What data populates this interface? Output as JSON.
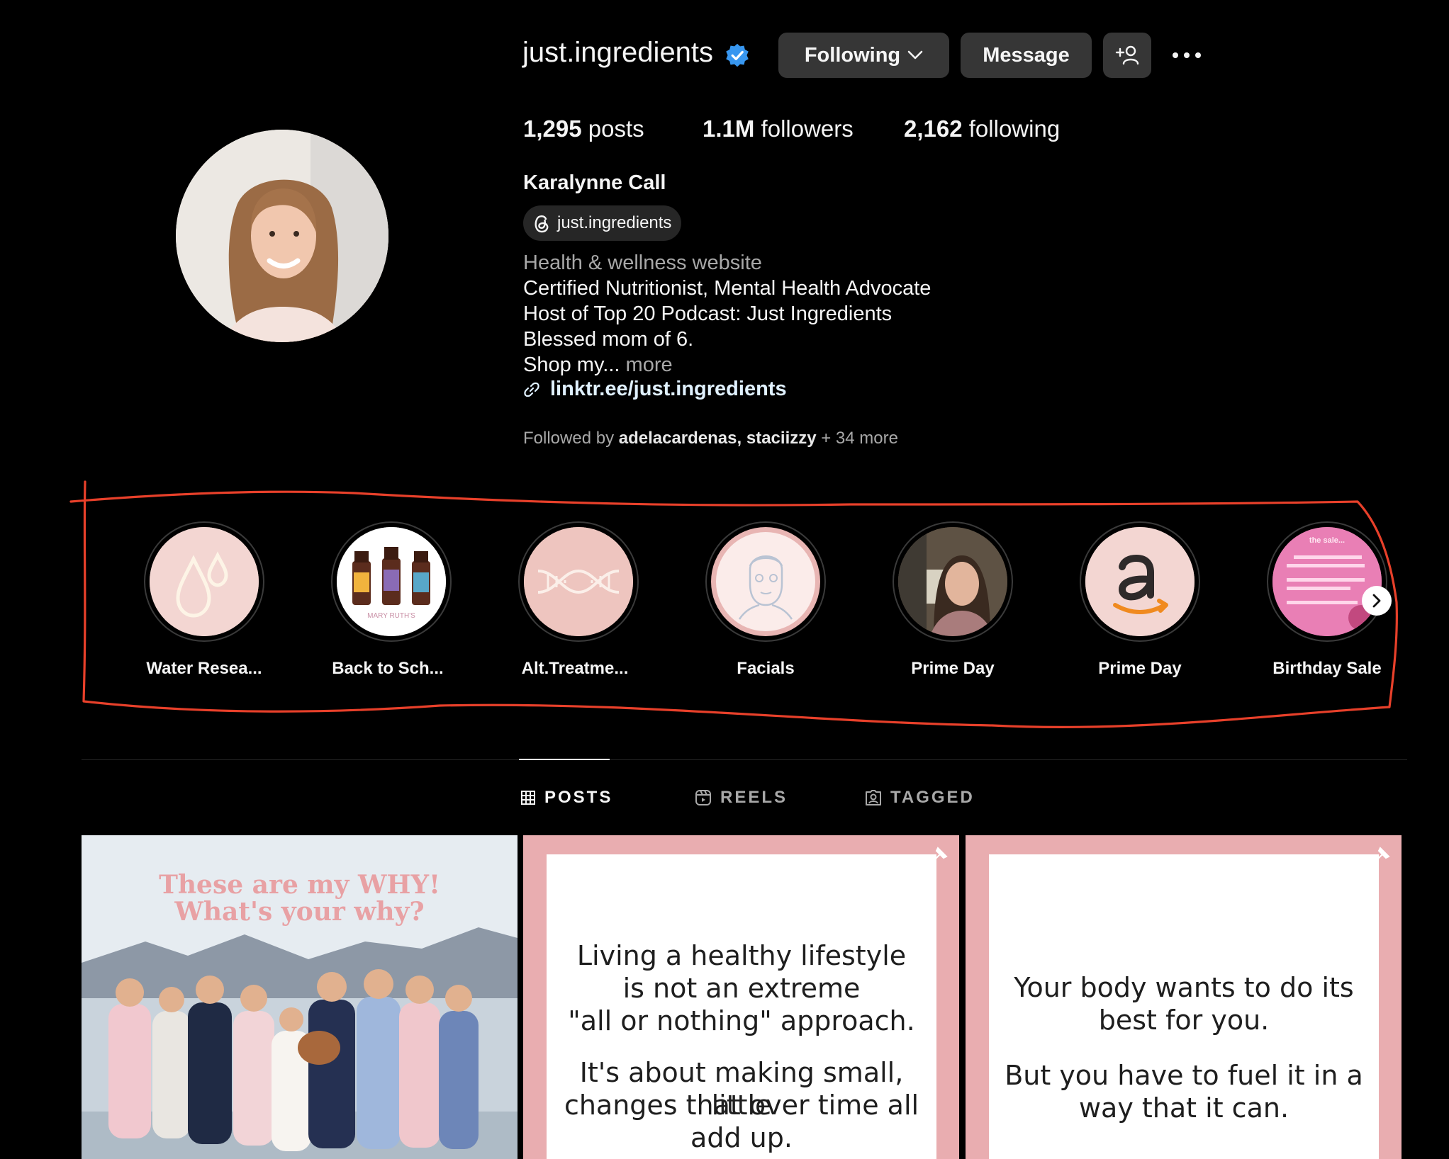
{
  "header": {
    "username": "just.ingredients",
    "following_label": "Following",
    "message_label": "Message"
  },
  "stats": {
    "posts_count": "1,295",
    "posts_label": "posts",
    "followers_count": "1.1M",
    "followers_label": "followers",
    "following_count": "2,162",
    "following_label": "following"
  },
  "bio": {
    "full_name": "Karalynne Call",
    "threads_handle": "just.ingredients",
    "category": "Health & wellness website",
    "lines": [
      "Certified Nutritionist, Mental Health Advocate",
      "Host of Top 20 Podcast: Just Ingredients",
      "Blessed mom of 6."
    ],
    "truncated_line": "Shop my...",
    "more_label": "more",
    "link": "linktr.ee/just.ingredients"
  },
  "followed_by": {
    "prefix": "Followed by",
    "user1": "adelacardenas",
    "separator": ",",
    "user2": "staciizzy",
    "suffix": "+ 34 more"
  },
  "highlights": [
    {
      "label": "Water Resea...",
      "icon": "water-drops-icon"
    },
    {
      "label": "Back to Sch...",
      "icon": "product-bottles"
    },
    {
      "label": "Alt.Treatme...",
      "icon": "dna-icon"
    },
    {
      "label": "Facials",
      "icon": "face-mask-icon"
    },
    {
      "label": "Prime Day",
      "icon": "person-photo"
    },
    {
      "label": "Prime Day",
      "icon": "amazon-logo"
    },
    {
      "label": "Birthday Sale",
      "icon": "sale-graphic"
    }
  ],
  "highlight_images": {
    "bottles_caption": "MARY RUTH'S",
    "sale_title": "the sale..."
  },
  "tabs": [
    {
      "label": "POSTS",
      "icon": "grid-icon",
      "active": true
    },
    {
      "label": "REELS",
      "icon": "reels-icon",
      "active": false
    },
    {
      "label": "TAGGED",
      "icon": "tagged-icon",
      "active": false
    }
  ],
  "posts": {
    "post1": {
      "line1": "These are my WHY!",
      "line2": "What's your why?"
    },
    "post2": {
      "lines_a": [
        "Living a healthy lifestyle",
        "is not an extreme",
        "\"all or nothing\" approach."
      ],
      "lines_b": [
        "It's about making small, little",
        "changes that over time all",
        "add up."
      ]
    },
    "post3": {
      "lines_a": [
        "Your body wants to do its",
        "best for you."
      ],
      "lines_b": [
        "But you have to fuel it in a",
        "way that it can."
      ]
    }
  },
  "colors": {
    "background": "#000000",
    "button": "#363636",
    "verified": "#3897f0",
    "link": "#e0f1ff",
    "annotation": "#e8402a",
    "post_pink": "#e9adb0"
  }
}
